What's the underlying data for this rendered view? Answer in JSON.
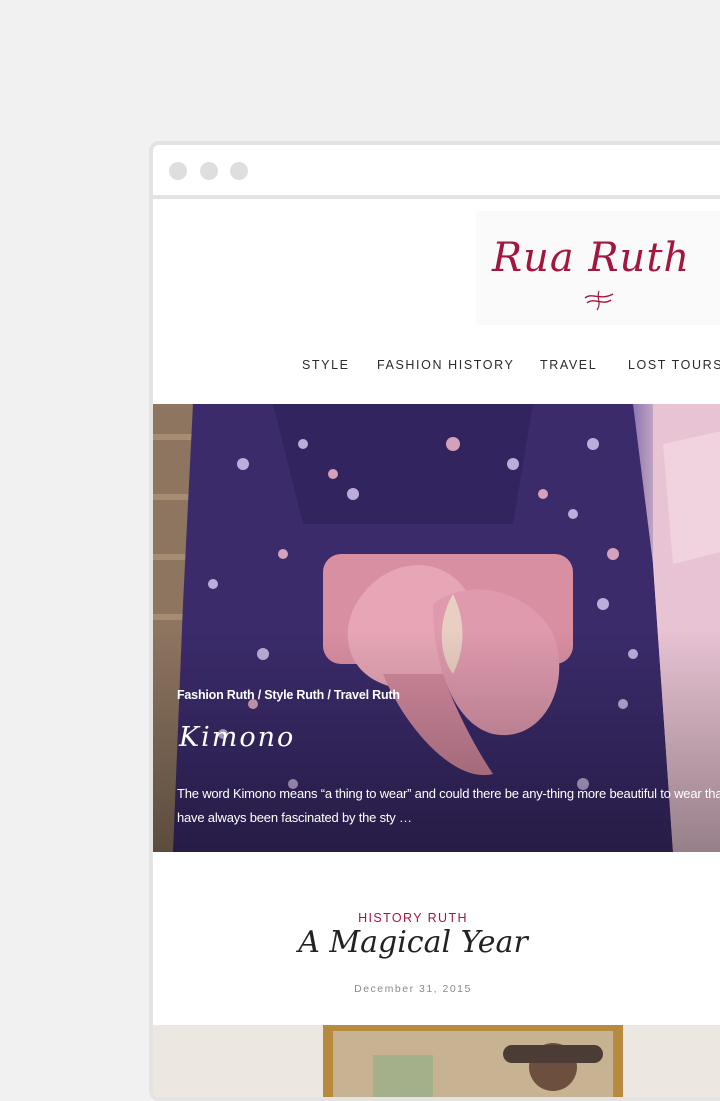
{
  "site": {
    "logo_text": "Rua Ruth"
  },
  "nav": {
    "items": [
      "STYLE",
      "FASHION HISTORY",
      "TRAVEL",
      "LOST TOURS"
    ]
  },
  "hero": {
    "categories": "Fashion Ruth / Style Ruth / Travel Ruth",
    "title": "Kimono",
    "excerpt": "The word Kimono means “a thing to wear” and could there be any-thing more beautiful to wear than a kimono! I have always been fascinated by the sty …"
  },
  "post": {
    "category": "HISTORY RUTH",
    "title": "A Magical Year",
    "date": "December 31, 2015"
  },
  "colors": {
    "accent": "#a3173f",
    "page_bg": "#f1f1f1",
    "frame": "#e3e3e3"
  },
  "icons": {
    "logo_ornament": "swash-icon",
    "hero_photo": "kimono-photo",
    "post_photo": "framed-portrait-photo"
  }
}
